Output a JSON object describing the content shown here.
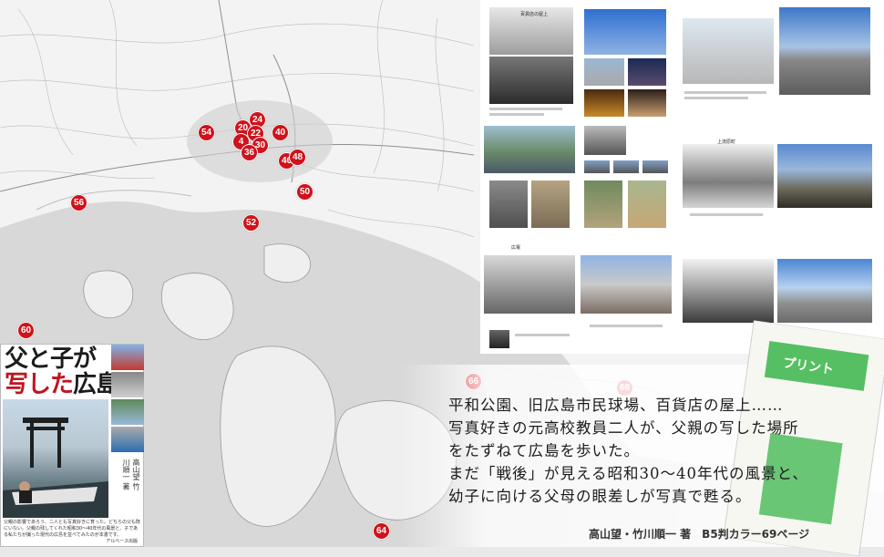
{
  "map": {
    "markers": [
      {
        "label": "54"
      },
      {
        "label": "20"
      },
      {
        "label": "24"
      },
      {
        "label": "22"
      },
      {
        "label": "4"
      },
      {
        "label": "30"
      },
      {
        "label": "36"
      },
      {
        "label": "40"
      },
      {
        "label": "46"
      },
      {
        "label": "48"
      },
      {
        "label": "56"
      },
      {
        "label": "50"
      },
      {
        "label": "52"
      },
      {
        "label": "60"
      },
      {
        "label": "66"
      },
      {
        "label": "68"
      },
      {
        "label": "64"
      }
    ]
  },
  "book_cover": {
    "title_part1": "父と子が",
    "title_part2": "写した",
    "title_part3": "広島",
    "authors_vertical": "高山望 竹川順一 著",
    "description": "父親の影響であろう、二人とも写真好きに育った。どちらの父も既にいない。父親の残してくれた昭和30〜40年代の風景と、子である私たちが撮った現代の広島を並べてみたのが本書です。",
    "publisher": "アルベース出版"
  },
  "spread": {
    "caption_small": "百貨店の屋上",
    "caption_section": "上流原町",
    "caption_station": "広電"
  },
  "flyer": {
    "label": "プリント"
  },
  "description_lines": [
    "平和公園、旧広島市民球場、百貨店の屋上……",
    "写真好きの元高校教員二人が、父親の写した場所",
    "をたずねて広島を歩いた。",
    "まだ「戦後」が見える昭和30〜40年代の風景と、",
    "幼子に向ける父母の眼差しが写真で甦る。"
  ],
  "credit": "高山望・竹川順一 著　B5判カラー69ページ",
  "colors": {
    "marker": "#d0121b",
    "sea": "#d9d9d9",
    "land": "#f4f4f4",
    "flyer_green": "#39b54a"
  }
}
